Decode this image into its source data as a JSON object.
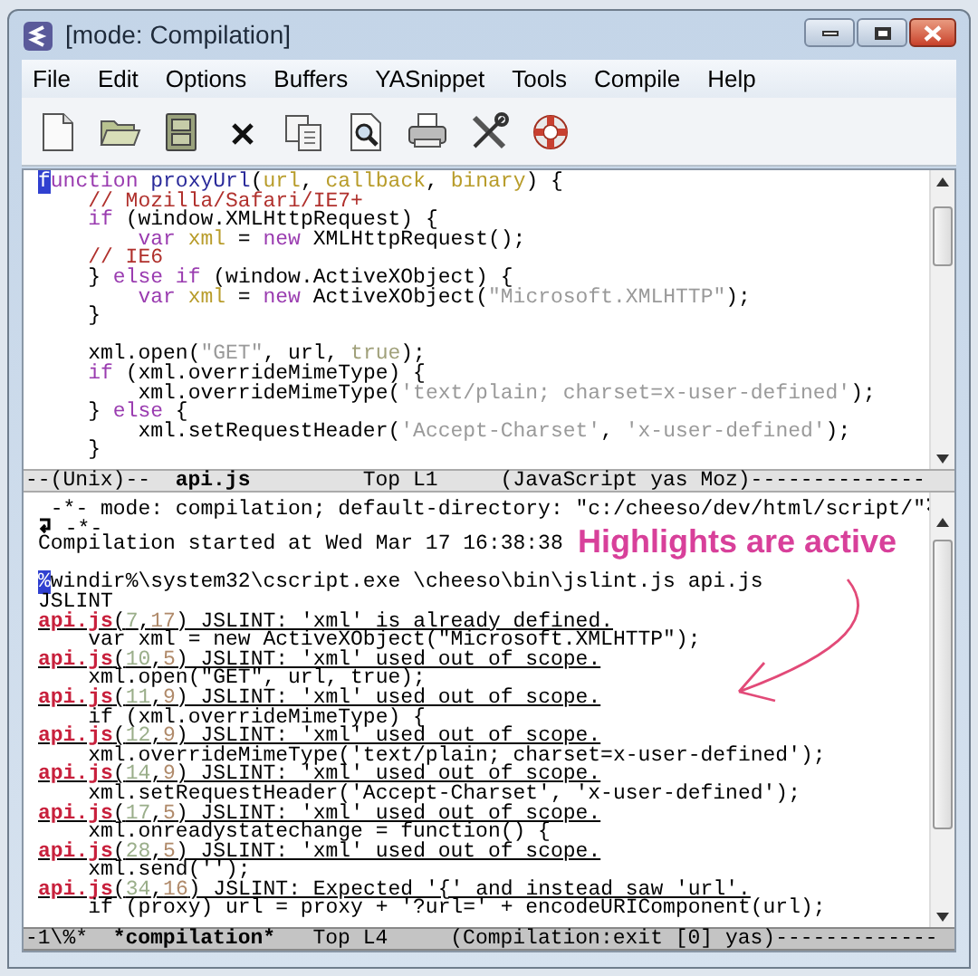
{
  "window": {
    "title": "[mode: Compilation]"
  },
  "menu": [
    "File",
    "Edit",
    "Options",
    "Buffers",
    "YASnippet",
    "Tools",
    "Compile",
    "Help"
  ],
  "toolbar": [
    {
      "kind": "new"
    },
    {
      "kind": "open"
    },
    {
      "kind": "save"
    },
    {
      "kind": "close"
    },
    {
      "kind": "copy"
    },
    {
      "kind": "find"
    },
    {
      "kind": "print"
    },
    {
      "kind": "tools"
    },
    {
      "kind": "help"
    }
  ],
  "editor": {
    "lines": [
      {
        "kind": "code",
        "segments": [
          {
            "text": "f",
            "kind": "cursor"
          },
          {
            "text": "unction",
            "kind": "keyword"
          },
          {
            "text": " proxyUrl",
            "kind": "function"
          },
          {
            "text": "(",
            "kind": "plain"
          },
          {
            "text": "url",
            "kind": "variable"
          },
          {
            "text": ", ",
            "kind": "plain"
          },
          {
            "text": "callback",
            "kind": "variable"
          },
          {
            "text": ", ",
            "kind": "plain"
          },
          {
            "text": "binary",
            "kind": "variable"
          },
          {
            "text": ") {",
            "kind": "plain"
          }
        ]
      },
      {
        "kind": "code",
        "segments": [
          {
            "text": "    // Mozilla/Safari/IE7+",
            "kind": "comment"
          }
        ]
      },
      {
        "kind": "code",
        "segments": [
          {
            "text": "    if",
            "kind": "keyword"
          },
          {
            "text": " (window.XMLHttpRequest) {",
            "kind": "plain"
          }
        ]
      },
      {
        "kind": "code",
        "segments": [
          {
            "text": "        var",
            "kind": "keyword"
          },
          {
            "text": " xml",
            "kind": "variable"
          },
          {
            "text": " = ",
            "kind": "plain"
          },
          {
            "text": "new",
            "kind": "keyword"
          },
          {
            "text": " XMLHttpRequest();",
            "kind": "plain"
          }
        ]
      },
      {
        "kind": "code",
        "segments": [
          {
            "text": "    // IE6",
            "kind": "comment"
          }
        ]
      },
      {
        "kind": "code",
        "segments": [
          {
            "text": "    } ",
            "kind": "plain"
          },
          {
            "text": "else if",
            "kind": "keyword"
          },
          {
            "text": " (window.ActiveXObject) {",
            "kind": "plain"
          }
        ]
      },
      {
        "kind": "code",
        "segments": [
          {
            "text": "        var",
            "kind": "keyword"
          },
          {
            "text": " xml",
            "kind": "variable"
          },
          {
            "text": " = ",
            "kind": "plain"
          },
          {
            "text": "new",
            "kind": "keyword"
          },
          {
            "text": " ActiveXObject(",
            "kind": "plain"
          },
          {
            "text": "\"Microsoft.XMLHTTP\"",
            "kind": "string"
          },
          {
            "text": ");",
            "kind": "plain"
          }
        ]
      },
      {
        "kind": "code",
        "segments": [
          {
            "text": "    }",
            "kind": "plain"
          }
        ]
      },
      {
        "kind": "blank"
      },
      {
        "kind": "code",
        "segments": [
          {
            "text": "    xml.open(",
            "kind": "plain"
          },
          {
            "text": "\"GET\"",
            "kind": "string"
          },
          {
            "text": ", url, ",
            "kind": "plain"
          },
          {
            "text": "true",
            "kind": "constant"
          },
          {
            "text": ");",
            "kind": "plain"
          }
        ]
      },
      {
        "kind": "code",
        "segments": [
          {
            "text": "    if",
            "kind": "keyword"
          },
          {
            "text": " (xml.overrideMimeType) {",
            "kind": "plain"
          }
        ]
      },
      {
        "kind": "code",
        "segments": [
          {
            "text": "        xml.overrideMimeType(",
            "kind": "plain"
          },
          {
            "text": "'text/plain; charset=x-user-defined'",
            "kind": "string"
          },
          {
            "text": ");",
            "kind": "plain"
          }
        ]
      },
      {
        "kind": "code",
        "segments": [
          {
            "text": "    } ",
            "kind": "plain"
          },
          {
            "text": "else",
            "kind": "keyword"
          },
          {
            "text": " {",
            "kind": "plain"
          }
        ]
      },
      {
        "kind": "code",
        "segments": [
          {
            "text": "        xml.setRequestHeader(",
            "kind": "plain"
          },
          {
            "text": "'Accept-Charset'",
            "kind": "string"
          },
          {
            "text": ", ",
            "kind": "plain"
          },
          {
            "text": "'x-user-defined'",
            "kind": "string"
          },
          {
            "text": ");",
            "kind": "plain"
          }
        ]
      },
      {
        "kind": "code",
        "segments": [
          {
            "text": "    }",
            "kind": "plain"
          }
        ]
      }
    ]
  },
  "editor_mode_line": [
    {
      "text": "--(Unix)--  ",
      "kind": "plain"
    },
    {
      "text": "api.js",
      "kind": "bold"
    },
    {
      "text": "         Top L1     (JavaScript yas Moz)--------------",
      "kind": "plain"
    }
  ],
  "compilation": {
    "lines": [
      {
        "kind": "wrapped_start",
        "segments": [
          {
            "text": " -*- mode: compilation; default-directory: \"c:/cheeso/dev/html/script/\"",
            "kind": "plain"
          }
        ]
      },
      {
        "kind": "wrapped_end",
        "segments": [
          {
            "text": " -*-",
            "kind": "plain"
          }
        ]
      },
      {
        "kind": "output",
        "segments": [
          {
            "text": "Compilation started at Wed Mar 17 16:38:38",
            "kind": "plain"
          }
        ]
      },
      {
        "kind": "blank"
      },
      {
        "kind": "output",
        "segments": [
          {
            "text": "%",
            "kind": "cursor"
          },
          {
            "text": "windir%\\system32\\cscript.exe \\cheeso\\bin\\jslint.js api.js",
            "kind": "plain"
          }
        ]
      },
      {
        "kind": "output",
        "segments": [
          {
            "text": "JSLINT",
            "kind": "plain"
          }
        ]
      },
      {
        "kind": "error",
        "segments": [
          {
            "text": "api.js",
            "kind": "file"
          },
          {
            "text": "(",
            "kind": "plain"
          },
          {
            "text": "7",
            "kind": "line_number"
          },
          {
            "text": ",",
            "kind": "plain"
          },
          {
            "text": "17",
            "kind": "column_number"
          },
          {
            "text": ") JSLINT: 'xml' is already defined.",
            "kind": "plain"
          }
        ]
      },
      {
        "kind": "output",
        "segments": [
          {
            "text": "    var xml = new ActiveXObject(\"Microsoft.XMLHTTP\");",
            "kind": "plain"
          }
        ]
      },
      {
        "kind": "error",
        "segments": [
          {
            "text": "api.js",
            "kind": "file"
          },
          {
            "text": "(",
            "kind": "plain"
          },
          {
            "text": "10",
            "kind": "line_number"
          },
          {
            "text": ",",
            "kind": "plain"
          },
          {
            "text": "5",
            "kind": "column_number"
          },
          {
            "text": ") JSLINT: 'xml' used out of scope.",
            "kind": "plain"
          }
        ]
      },
      {
        "kind": "output",
        "segments": [
          {
            "text": "    xml.open(\"GET\", url, true);",
            "kind": "plain"
          }
        ]
      },
      {
        "kind": "error",
        "segments": [
          {
            "text": "api.js",
            "kind": "file"
          },
          {
            "text": "(",
            "kind": "plain"
          },
          {
            "text": "11",
            "kind": "line_number"
          },
          {
            "text": ",",
            "kind": "plain"
          },
          {
            "text": "9",
            "kind": "column_number"
          },
          {
            "text": ") JSLINT: 'xml' used out of scope.",
            "kind": "plain"
          }
        ]
      },
      {
        "kind": "output",
        "segments": [
          {
            "text": "    if (xml.overrideMimeType) {",
            "kind": "plain"
          }
        ]
      },
      {
        "kind": "error",
        "segments": [
          {
            "text": "api.js",
            "kind": "file"
          },
          {
            "text": "(",
            "kind": "plain"
          },
          {
            "text": "12",
            "kind": "line_number"
          },
          {
            "text": ",",
            "kind": "plain"
          },
          {
            "text": "9",
            "kind": "column_number"
          },
          {
            "text": ") JSLINT: 'xml' used out of scope.",
            "kind": "plain"
          }
        ]
      },
      {
        "kind": "output",
        "segments": [
          {
            "text": "    xml.overrideMimeType('text/plain; charset=x-user-defined');",
            "kind": "plain"
          }
        ]
      },
      {
        "kind": "error",
        "segments": [
          {
            "text": "api.js",
            "kind": "file"
          },
          {
            "text": "(",
            "kind": "plain"
          },
          {
            "text": "14",
            "kind": "line_number"
          },
          {
            "text": ",",
            "kind": "plain"
          },
          {
            "text": "9",
            "kind": "column_number"
          },
          {
            "text": ") JSLINT: 'xml' used out of scope.",
            "kind": "plain"
          }
        ]
      },
      {
        "kind": "output",
        "segments": [
          {
            "text": "    xml.setRequestHeader('Accept-Charset', 'x-user-defined');",
            "kind": "plain"
          }
        ]
      },
      {
        "kind": "error",
        "segments": [
          {
            "text": "api.js",
            "kind": "file"
          },
          {
            "text": "(",
            "kind": "plain"
          },
          {
            "text": "17",
            "kind": "line_number"
          },
          {
            "text": ",",
            "kind": "plain"
          },
          {
            "text": "5",
            "kind": "column_number"
          },
          {
            "text": ") JSLINT: 'xml' used out of scope.",
            "kind": "plain"
          }
        ]
      },
      {
        "kind": "output",
        "segments": [
          {
            "text": "    xml.onreadystatechange = function() {",
            "kind": "plain"
          }
        ]
      },
      {
        "kind": "error",
        "segments": [
          {
            "text": "api.js",
            "kind": "file"
          },
          {
            "text": "(",
            "kind": "plain"
          },
          {
            "text": "28",
            "kind": "line_number"
          },
          {
            "text": ",",
            "kind": "plain"
          },
          {
            "text": "5",
            "kind": "column_number"
          },
          {
            "text": ") JSLINT: 'xml' used out of scope.",
            "kind": "plain"
          }
        ]
      },
      {
        "kind": "output",
        "segments": [
          {
            "text": "    xml.send('');",
            "kind": "plain"
          }
        ]
      },
      {
        "kind": "error",
        "segments": [
          {
            "text": "api.js",
            "kind": "file"
          },
          {
            "text": "(",
            "kind": "plain"
          },
          {
            "text": "34",
            "kind": "line_number"
          },
          {
            "text": ",",
            "kind": "plain"
          },
          {
            "text": "16",
            "kind": "column_number"
          },
          {
            "text": ") JSLINT: Expected '{' and instead saw 'url'.",
            "kind": "plain"
          }
        ]
      },
      {
        "kind": "output",
        "segments": [
          {
            "text": "    if (proxy) url = proxy + '?url=' + encodeURIComponent(url);",
            "kind": "plain"
          }
        ]
      }
    ]
  },
  "annotation": {
    "text": "Highlights are active"
  },
  "compilation_mode_line": [
    {
      "text": "-1\\%*  ",
      "kind": "plain"
    },
    {
      "text": "*compilation*",
      "kind": "bold"
    },
    {
      "text": "   Top L4     (Compilation:exit [0] yas)-------------",
      "kind": "plain"
    }
  ]
}
